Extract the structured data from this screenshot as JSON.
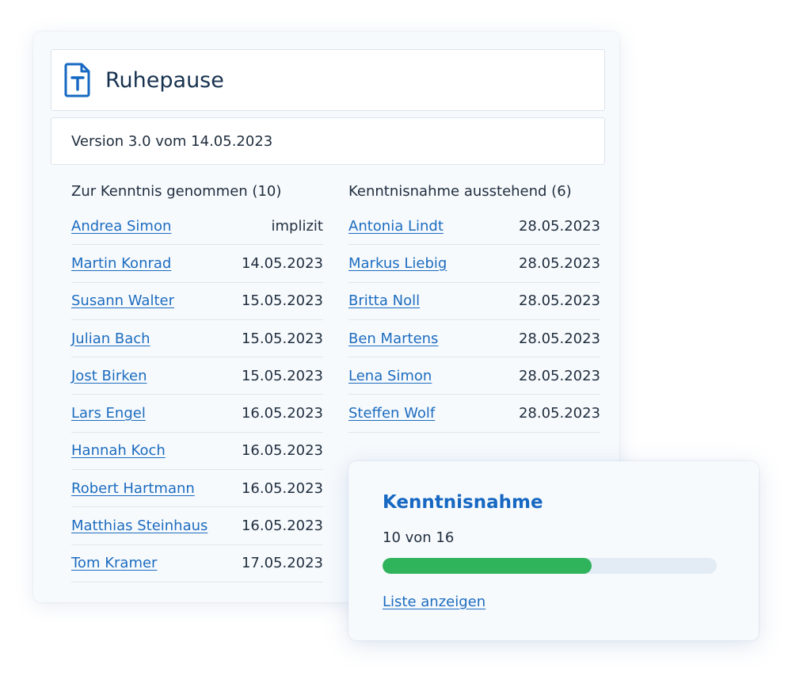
{
  "document": {
    "title": "Ruhepause",
    "icon": "document-text-icon",
    "version": "Version 3.0 vom 14.05.2023"
  },
  "acknowledged": {
    "heading": "Zur Kenntnis genommen (10)",
    "rows": [
      {
        "name": "Andrea Simon",
        "date": "implizit"
      },
      {
        "name": "Martin Konrad",
        "date": "14.05.2023"
      },
      {
        "name": "Susann Walter",
        "date": "15.05.2023"
      },
      {
        "name": "Julian Bach",
        "date": "15.05.2023"
      },
      {
        "name": "Jost Birken",
        "date": "15.05.2023"
      },
      {
        "name": "Lars Engel",
        "date": "16.05.2023"
      },
      {
        "name": "Hannah Koch",
        "date": "16.05.2023"
      },
      {
        "name": "Robert Hartmann",
        "date": "16.05.2023"
      },
      {
        "name": "Matthias Steinhaus",
        "date": "16.05.2023"
      },
      {
        "name": "Tom Kramer",
        "date": "17.05.2023"
      }
    ]
  },
  "pending": {
    "heading": "Kenntnisnahme ausstehend (6)",
    "rows": [
      {
        "name": "Antonia Lindt",
        "date": "28.05.2023"
      },
      {
        "name": "Markus Liebig",
        "date": "28.05.2023"
      },
      {
        "name": "Britta Noll",
        "date": "28.05.2023"
      },
      {
        "name": "Ben Martens",
        "date": "28.05.2023"
      },
      {
        "name": "Lena Simon",
        "date": "28.05.2023"
      },
      {
        "name": "Steffen Wolf",
        "date": "28.05.2023"
      }
    ]
  },
  "progress": {
    "title": "Kenntnisnahme",
    "count_text": "10 von 16",
    "done": 10,
    "total": 16,
    "link_label": "Liste anzeigen"
  },
  "colors": {
    "link": "#1c6cbf",
    "accent": "#1668c2",
    "progress_fill": "#2fb35b",
    "progress_track": "#e3ebf4"
  }
}
